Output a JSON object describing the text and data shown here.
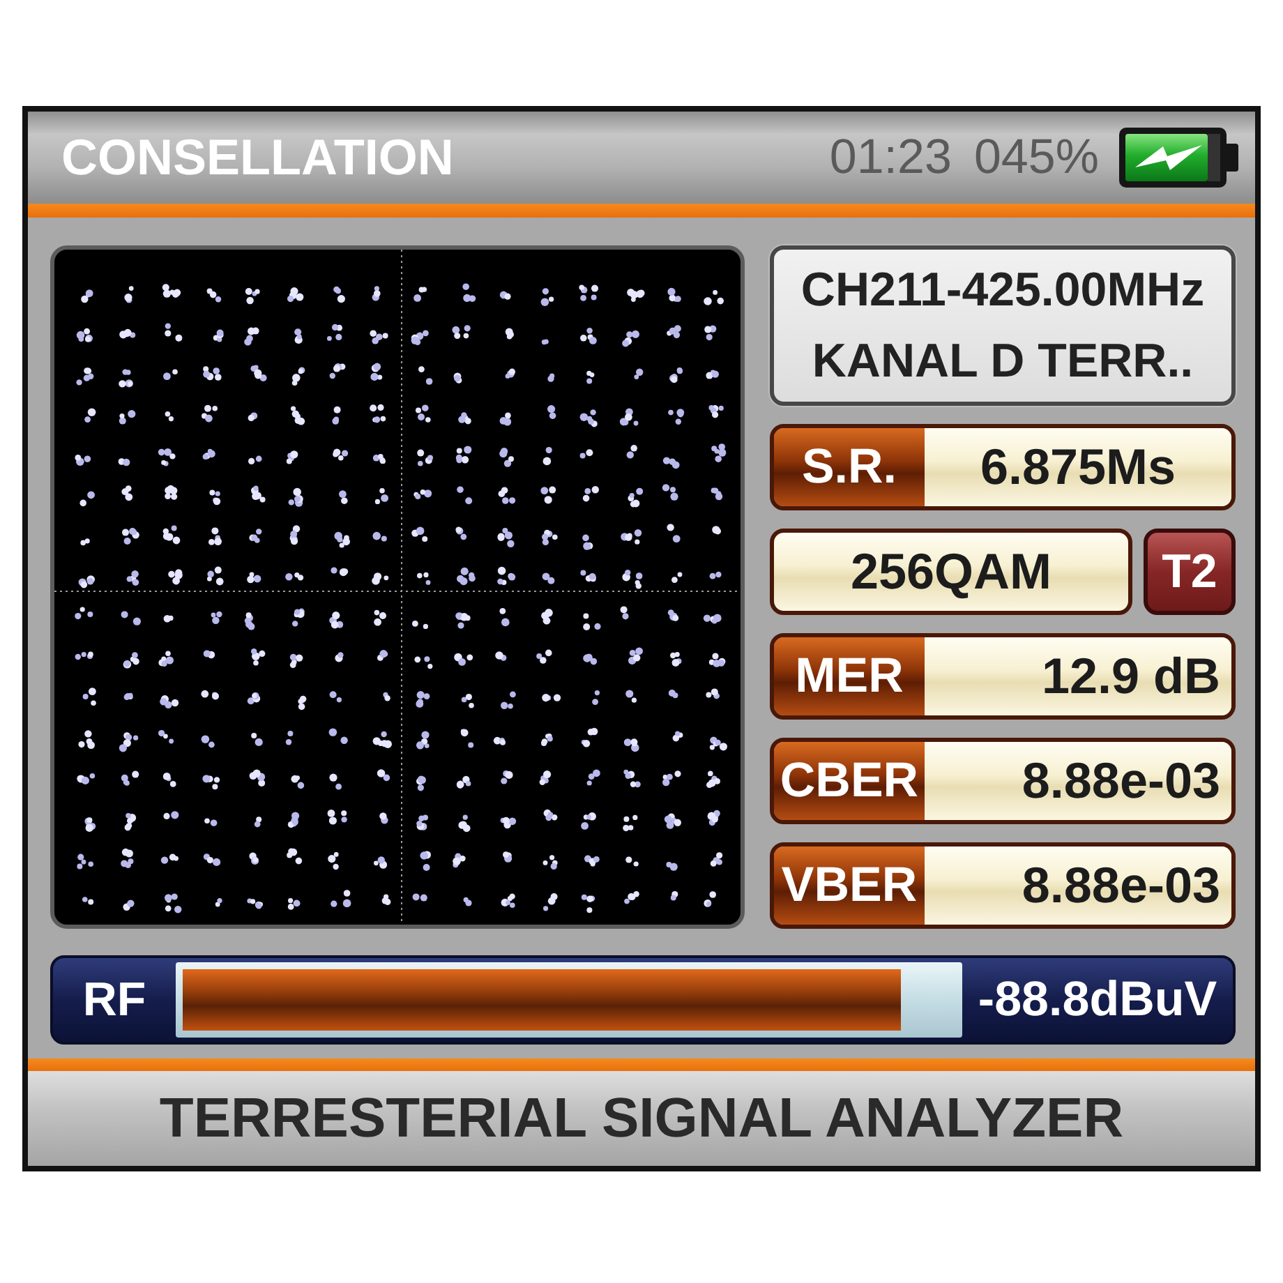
{
  "header": {
    "title": "CONSELLATION",
    "time": "01:23",
    "battery": "045%"
  },
  "channel": {
    "frequency": "CH211-425.00MHz",
    "name": "KANAL D TERR.."
  },
  "parameters": [
    {
      "kind": "setting",
      "label": "S.R.",
      "value": "6.875Ms"
    },
    {
      "kind": "modulation",
      "value": "256QAM",
      "badge": "T2"
    },
    {
      "kind": "measurement",
      "label": "MER",
      "value": "12.9 dB"
    },
    {
      "kind": "measurement",
      "label": "CBER",
      "value": "8.88e-03"
    },
    {
      "kind": "measurement",
      "label": "VBER",
      "value": "8.88e-03"
    }
  ],
  "rf": {
    "label": "RF",
    "level": 0.93,
    "reading": "-88.8dBuV"
  },
  "footer": {
    "title": "TERRESTERIAL SIGNAL ANALYZER"
  }
}
